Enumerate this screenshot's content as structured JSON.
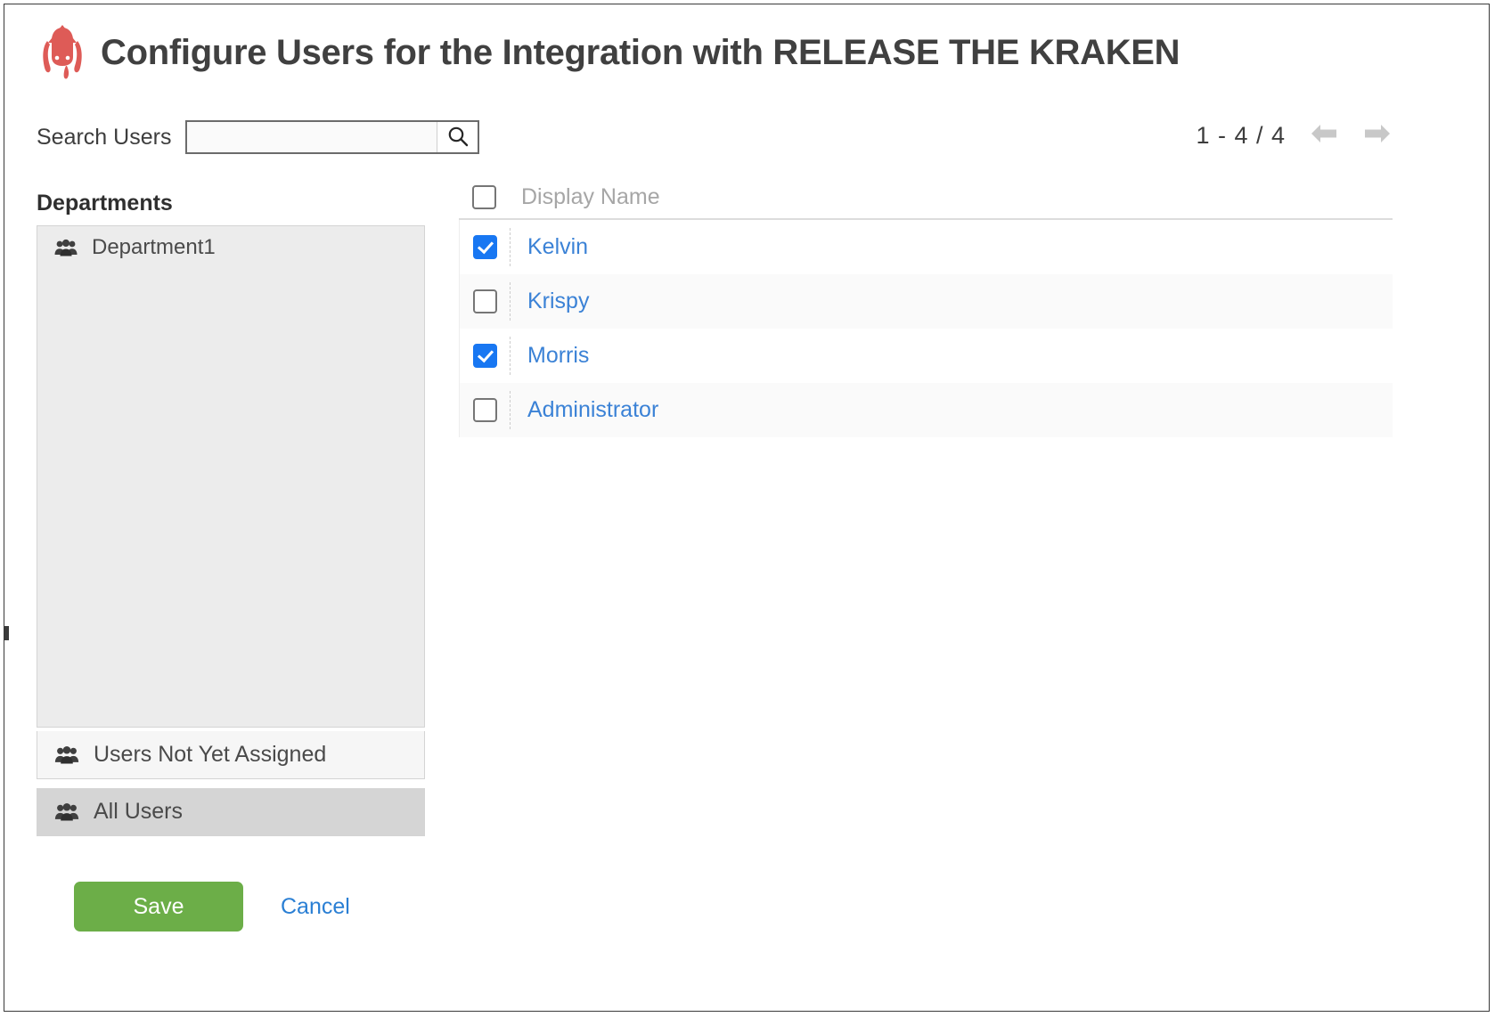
{
  "header": {
    "logo_icon": "kraken-squid-logo",
    "logo_color": "#de5b57",
    "title": "Configure Users for the Integration with RELEASE THE KRAKEN"
  },
  "search": {
    "label": "Search Users",
    "value": "",
    "placeholder": "",
    "button_icon": "search-icon"
  },
  "pagination": {
    "range_text": "1 - 4 / 4",
    "prev_icon": "arrow-left-icon",
    "next_icon": "arrow-right-icon",
    "arrow_color": "#c8c8c8"
  },
  "departments": {
    "heading": "Departments",
    "items": [
      {
        "label": "Department1",
        "icon": "users-group-icon",
        "selected": false
      }
    ],
    "fixed_items": [
      {
        "label": "Users Not Yet Assigned",
        "icon": "users-group-icon",
        "selected": false
      },
      {
        "label": "All Users",
        "icon": "users-group-icon",
        "selected": true
      }
    ]
  },
  "users_table": {
    "select_all_checked": false,
    "columns": [
      "Display Name"
    ],
    "rows": [
      {
        "name": "Kelvin",
        "checked": true
      },
      {
        "name": "Krispy",
        "checked": false
      },
      {
        "name": "Morris",
        "checked": true
      },
      {
        "name": "Administrator",
        "checked": false
      }
    ],
    "link_color": "#3b82d6",
    "checkbox_color": "#1877f2"
  },
  "actions": {
    "save_label": "Save",
    "cancel_label": "Cancel",
    "save_color": "#6cae48",
    "cancel_color": "#2a7fd4"
  }
}
